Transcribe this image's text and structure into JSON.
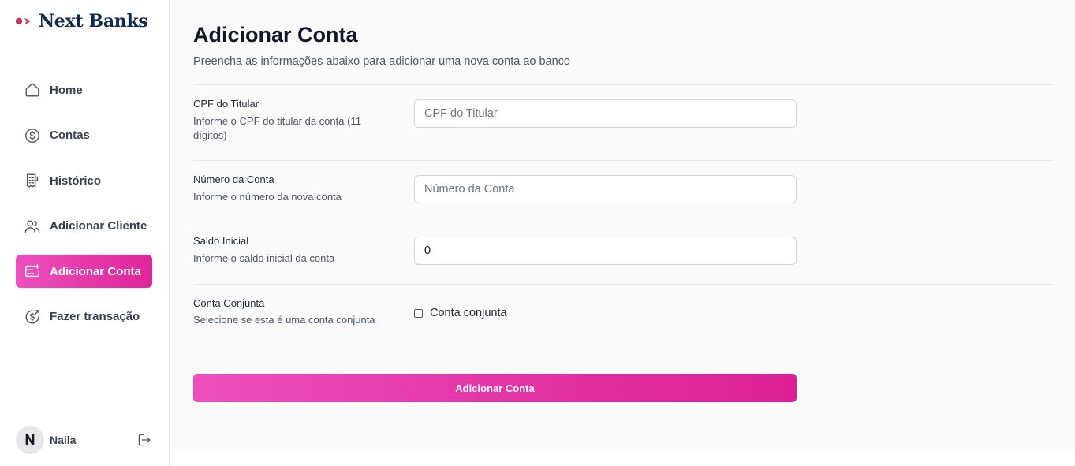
{
  "brand": {
    "name": "Next Banks"
  },
  "sidebar": {
    "items": [
      {
        "label": "Home",
        "icon": "home-icon"
      },
      {
        "label": "Contas",
        "icon": "dollar-circle-icon"
      },
      {
        "label": "Histórico",
        "icon": "receipt-icon"
      },
      {
        "label": "Adicionar Cliente",
        "icon": "users-icon"
      },
      {
        "label": "Adicionar Conta",
        "icon": "card-add-icon",
        "active": true
      },
      {
        "label": "Fazer transação",
        "icon": "dollar-send-icon"
      }
    ]
  },
  "user": {
    "initial": "N",
    "name": "Naila",
    "logout_icon": "logout-icon"
  },
  "page": {
    "title": "Adicionar Conta",
    "subtitle": "Preencha as informações abaixo para adicionar uma nova conta ao banco"
  },
  "form": {
    "cpf": {
      "label": "CPF do Titular",
      "help": "Informe o CPF do titular da conta (11 dígitos)",
      "placeholder": "CPF do Titular",
      "value": ""
    },
    "numero": {
      "label": "Número da Conta",
      "help": "Informe o número da nova conta",
      "placeholder": "Número da Conta",
      "value": ""
    },
    "saldo": {
      "label": "Saldo Inicial",
      "help": "Informe o saldo inicial da conta",
      "value": "0"
    },
    "conjunta": {
      "label": "Conta Conjunta",
      "help": "Selecione se esta é uma conta conjunta",
      "checkbox_label": "Conta conjunta",
      "checked": false
    },
    "submit_label": "Adicionar Conta"
  },
  "colors": {
    "accent_start": "#ec4fbd",
    "accent_end": "#dc1f94",
    "brand_navy": "#0f2a4f",
    "brand_mark": "#c0395a"
  }
}
